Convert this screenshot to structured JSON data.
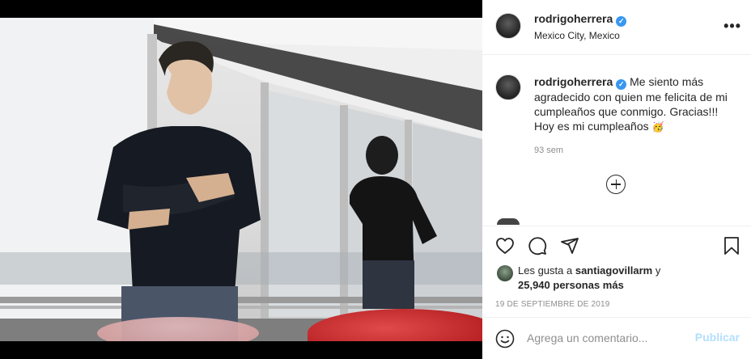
{
  "post": {
    "username": "rodrigoherrera",
    "location": "Mexico City, Mexico",
    "more_icon": "more-options-icon",
    "caption_text": "Me siento más agradecido con quien me felicita de mi cumpleaños que conmigo. Gracias!!! Hoy es mi cumpleaños",
    "caption_emoji": "🥳",
    "time_ago": "93 sem",
    "likes_prefix": "Les gusta a",
    "liker": "santiagovillarm",
    "likes_conj": "y",
    "likes_count": "25,940 personas más",
    "date": "19 DE SEPTIEMBRE DE 2019"
  },
  "icons": {
    "like": "heart-icon",
    "comment": "comment-icon",
    "share": "share-icon",
    "save": "bookmark-icon",
    "emoji": "smiley-icon",
    "load_more": "plus-circle-icon",
    "verified": "verified-badge-icon"
  },
  "comment_box": {
    "placeholder": "Agrega un comentario...",
    "publish_label": "Publicar"
  },
  "colors": {
    "verified_blue": "#3897f0",
    "publish_disabled": "#b2dffc",
    "muted_text": "#8e8e8e",
    "border": "#efefef"
  }
}
